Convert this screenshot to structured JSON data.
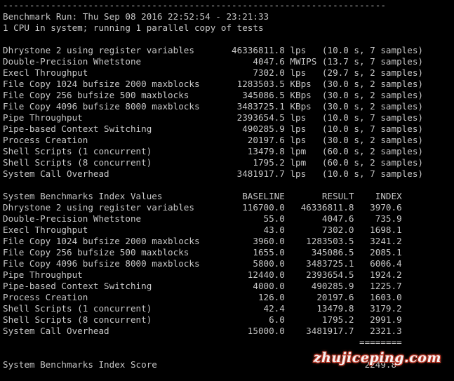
{
  "terminal": {
    "separator": "------------------------------------------------------------------------",
    "run_header": "Benchmark Run: Thu Sep 08 2016 22:52:54 - 23:21:33",
    "cpu_info": "1 CPU in system; running 1 parallel copy of tests",
    "results": [
      "Dhrystone 2 using register variables       46336811.8 lps   (10.0 s, 7 samples)",
      "Double-Precision Whetstone                     4047.6 MWIPS (13.7 s, 7 samples)",
      "Execl Throughput                               7302.0 lps   (29.7 s, 2 samples)",
      "File Copy 1024 bufsize 2000 maxblocks       1283503.5 KBps  (30.0 s, 2 samples)",
      "File Copy 256 bufsize 500 maxblocks          345086.5 KBps  (30.0 s, 2 samples)",
      "File Copy 4096 bufsize 8000 maxblocks       3483725.1 KBps  (30.0 s, 2 samples)",
      "Pipe Throughput                             2393654.5 lps   (10.0 s, 7 samples)",
      "Pipe-based Context Switching                 490285.9 lps   (10.0 s, 7 samples)",
      "Process Creation                              20197.6 lps   (30.0 s, 2 samples)",
      "Shell Scripts (1 concurrent)                  13479.8 lpm   (60.0 s, 2 samples)",
      "Shell Scripts (8 concurrent)                   1795.2 lpm   (60.0 s, 2 samples)",
      "System Call Overhead                        3481917.7 lps   (10.0 s, 7 samples)"
    ],
    "index_header": "System Benchmarks Index Values               BASELINE       RESULT    INDEX",
    "index_rows": [
      "Dhrystone 2 using register variables         116700.0   46336811.8   3970.6",
      "Double-Precision Whetstone                       55.0       4047.6    735.9",
      "Execl Throughput                                 43.0       7302.0   1698.1",
      "File Copy 1024 bufsize 2000 maxblocks          3960.0    1283503.5   3241.2",
      "File Copy 256 bufsize 500 maxblocks            1655.0     345086.5   2085.1",
      "File Copy 4096 bufsize 8000 maxblocks          5800.0    3483725.1   6006.4",
      "Pipe Throughput                               12440.0    2393654.5   1924.2",
      "Pipe-based Context Switching                   4000.0     490285.9   1225.7",
      "Process Creation                                126.0      20197.6   1603.0",
      "Shell Scripts (1 concurrent)                     42.4      13479.8   3179.2",
      "Shell Scripts (8 concurrent)                      6.0       1795.2   2991.9",
      "System Call Overhead                          15000.0    3481917.7   2321.3"
    ],
    "index_rule": "                                                                   ========",
    "index_score": "System Benchmarks Index Score                                       2249.8"
  },
  "watermark": "zhujiceping.com",
  "colors": {
    "background": "#000000",
    "text": "#c7c7c7",
    "watermark_glow": "#c23a2a"
  }
}
